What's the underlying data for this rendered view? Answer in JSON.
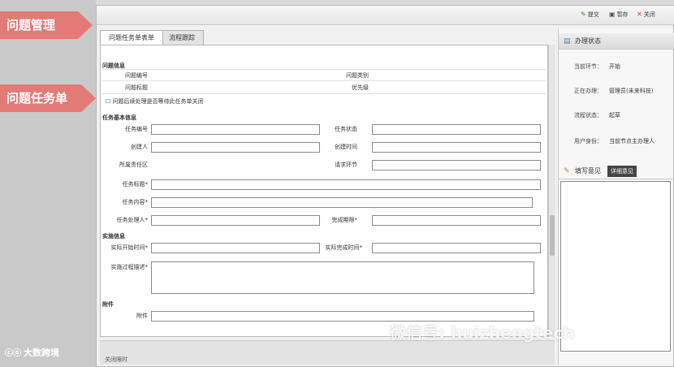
{
  "callouts": {
    "problem_management": "问题管理",
    "problem_task": "问题任务单"
  },
  "brand": {
    "logo_text": "ⓒⓞ",
    "name": "大数跨境"
  },
  "toolbar": {
    "submit": "提交",
    "save": "暂存",
    "close": "关闭"
  },
  "tabs": {
    "active": "问题任务单表单",
    "inactive": "流程跟踪"
  },
  "form": {
    "section_problem": "问题信息",
    "problem_no_label": "问题编号",
    "problem_type_label": "问题类别",
    "problem_title_label": "问题标题",
    "priority_label": "优先级",
    "checkbox_label": "问题后续处理是否等待此任务单关闭",
    "section_task": "任务基本信息",
    "task_no_label": "任务编号",
    "task_status_label": "任务状态",
    "creator_label": "创建人",
    "create_time_label": "创建时间",
    "resp_area_label": "所属责任区",
    "request_node_label": "请求环节",
    "task_title_label": "任务标题*",
    "task_content_label": "任务内容*",
    "task_handler_label": "任务处理人*",
    "deadline_label": "完成期限*",
    "section_impl": "实施信息",
    "actual_start_label": "实际开始时间*",
    "actual_end_label": "实际完成时间*",
    "process_desc_label": "实施过程描述*",
    "section_attach": "附件",
    "attach_label": "附件"
  },
  "status_bar": {
    "text": "关闭限时"
  },
  "side": {
    "status_title": "办理状态",
    "current_node_label": "当前环节：",
    "current_node_value": "开始",
    "handling_label": "正在办理：",
    "handling_value": "管理员(未来科技)",
    "flow_status_label": "流程状态：",
    "flow_status_value": "起草",
    "user_role_label": "用户身份：",
    "user_role_value": "当前节点主办理人",
    "opinion_title": "填写意见",
    "detail_button": "详细意见"
  },
  "watermark": "微信号: huizhengtech"
}
